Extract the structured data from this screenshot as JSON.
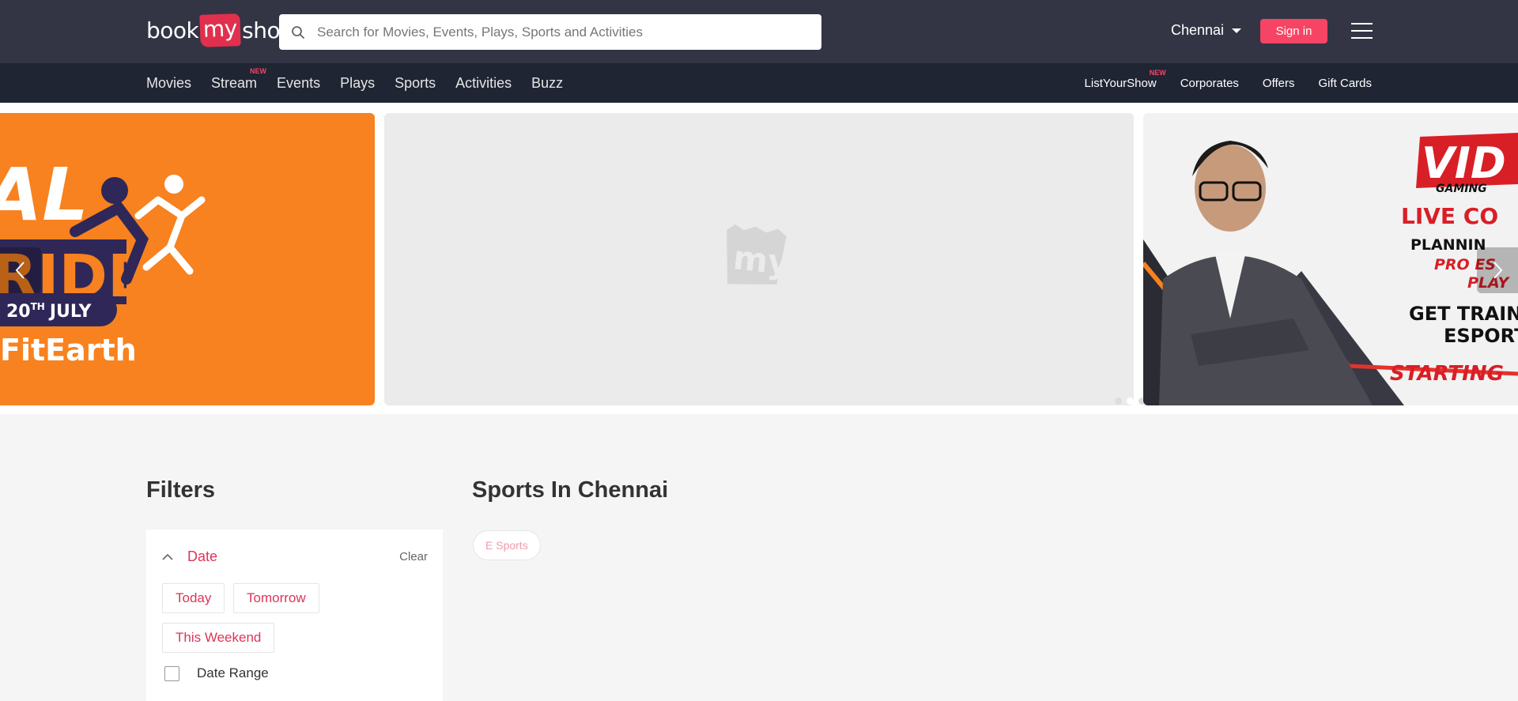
{
  "header": {
    "logo": {
      "part1": "book",
      "part2": "my",
      "part3": "show"
    },
    "search_placeholder": "Search for Movies, Events, Plays, Sports and Activities",
    "city": "Chennai",
    "signin": "Sign in"
  },
  "nav_left": [
    {
      "label": "Movies",
      "badge": ""
    },
    {
      "label": "Stream",
      "badge": "NEW"
    },
    {
      "label": "Events",
      "badge": ""
    },
    {
      "label": "Plays",
      "badge": ""
    },
    {
      "label": "Sports",
      "badge": ""
    },
    {
      "label": "Activities",
      "badge": ""
    },
    {
      "label": "Buzz",
      "badge": ""
    }
  ],
  "nav_right": [
    {
      "label": "ListYourShow",
      "badge": "NEW"
    },
    {
      "label": "Corporates",
      "badge": ""
    },
    {
      "label": "Offers",
      "badge": ""
    },
    {
      "label": "Gift Cards",
      "badge": ""
    }
  ],
  "banner": {
    "left": {
      "line1": "AL",
      "line2": "RIDE",
      "date": "20",
      "date_sup": "TH",
      "month": "JULY",
      "tag": "FitEarth",
      "bg": "#f7821f"
    },
    "middle": {
      "placeholder": "my"
    },
    "right": {
      "title": "VID",
      "subtitle": "GAMING",
      "line1": "LIVE CO",
      "line2": "PLANNIN",
      "line3": "PRO ES",
      "line4": "PLAY",
      "line5": "GET TRAINED B",
      "line6": "ESPORTS C",
      "line7": "STARTING"
    },
    "dots": 4,
    "active_dot": 1
  },
  "filters": {
    "title": "Filters",
    "section": "Date",
    "clear": "Clear",
    "options": [
      "Today",
      "Tomorrow",
      "This Weekend"
    ],
    "range_label": "Date Range"
  },
  "main": {
    "title": "Sports In Chennai",
    "chips": [
      "E Sports"
    ]
  },
  "colors": {
    "accent": "#f84464",
    "header_bg": "#333545",
    "subnav_bg": "#1f2533",
    "filter_red": "#dc3558"
  }
}
